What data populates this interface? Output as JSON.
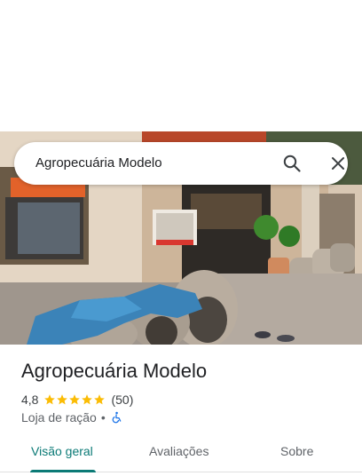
{
  "search": {
    "query": "Agropecuária Modelo"
  },
  "icons": {
    "search": "search-icon",
    "close": "close-icon",
    "accessibility": "wheelchair-icon",
    "star": "star-icon"
  },
  "place": {
    "name": "Agropecuária Modelo",
    "rating": "4,8",
    "rating_value": 4.8,
    "review_count": "(50)",
    "category": "Loja de ração",
    "separator": "•"
  },
  "tabs": [
    {
      "label": "Visão geral",
      "active": true
    },
    {
      "label": "Avaliações",
      "active": false
    },
    {
      "label": "Sobre",
      "active": false
    }
  ],
  "colors": {
    "accent": "#0b7a76",
    "star": "#fbbc04",
    "access_icon": "#1a73e8"
  }
}
